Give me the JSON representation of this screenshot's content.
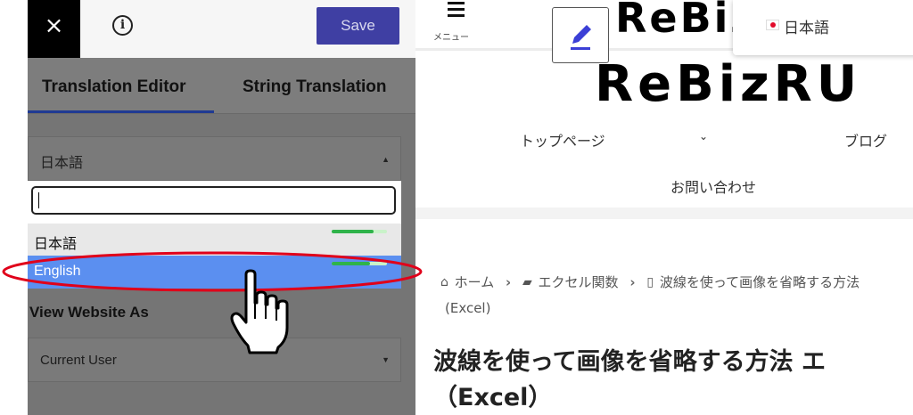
{
  "editor": {
    "close_icon": "×",
    "info_icon": "i",
    "save_label": "Save",
    "tabs": [
      {
        "label": "Translation Editor",
        "active": true
      },
      {
        "label": "String Translation",
        "active": false
      }
    ],
    "language_select": {
      "value": "日本語",
      "search_value": "",
      "options": [
        {
          "label": "日本語",
          "progress": 0.75,
          "highlighted": false
        },
        {
          "label": "English",
          "progress": 0.7,
          "highlighted": true
        }
      ]
    },
    "view_as_label": "View Website As",
    "view_as_select": {
      "value": "Current User"
    },
    "colors": {
      "save_button": "#3f3fa3",
      "tab_underline": "#1f3a93",
      "selected_option": "#5b8ff0",
      "progress": "#2fb34a",
      "highlight_ellipse": "#e0001a"
    }
  },
  "site": {
    "menu_label": "メニュー",
    "logo_top": "ReBiz",
    "logo_main": "ReBizRU",
    "language_switcher": {
      "label": "日本語",
      "flag": "japan-flag"
    },
    "nav": {
      "top_page": "トップページ",
      "blog": "ブログ",
      "contact": "お問い合わせ"
    },
    "breadcrumb": {
      "home": "ホーム",
      "category": "エクセル関数",
      "current": "波線を使って画像を省略する方法",
      "current_cont": "(Excel)"
    },
    "article_title_line1": "波線を使って画像を省略する方法 エ",
    "article_title_line2": "（Excel）"
  }
}
